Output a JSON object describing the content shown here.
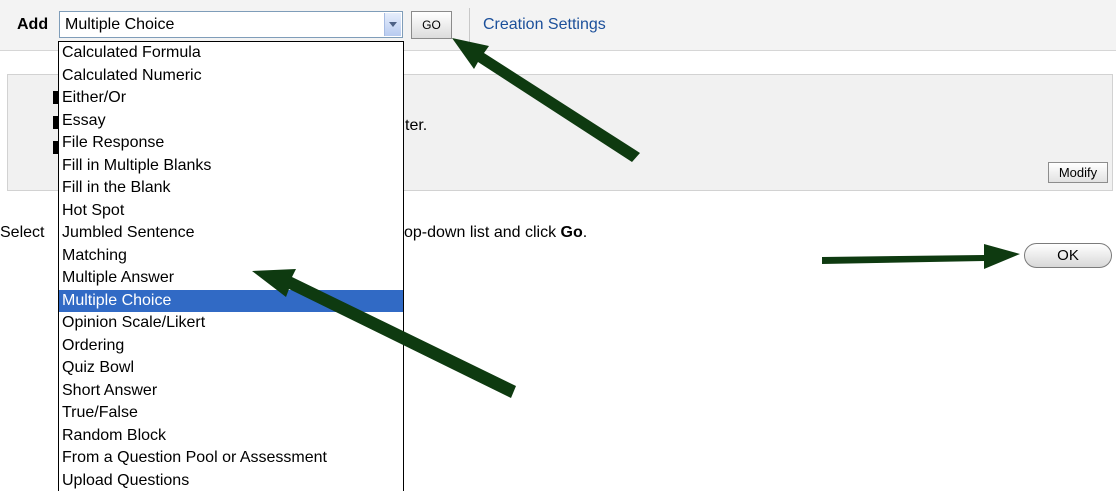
{
  "toolbar": {
    "add_label": "Add",
    "select_value": "Multiple Choice",
    "go_label": "GO",
    "creation_settings": "Creation Settings"
  },
  "info_box": {
    "line_fragment": "ter.",
    "modify_label": "Modify"
  },
  "instructions": {
    "prefix": "Select",
    "suffix_text": "op-down list and click ",
    "suffix_bold": "Go",
    "suffix_end": "."
  },
  "ok_label": "OK",
  "dropdown": {
    "options": [
      "Calculated Formula",
      "Calculated Numeric",
      "Either/Or",
      "Essay",
      "File Response",
      "Fill in Multiple Blanks",
      "Fill in the Blank",
      "Hot Spot",
      "Jumbled Sentence",
      "Matching",
      "Multiple Answer",
      "Multiple Choice",
      "Opinion Scale/Likert",
      "Ordering",
      "Quiz Bowl",
      "Short Answer",
      "True/False",
      "Random Block",
      "From a Question Pool or Assessment",
      "Upload Questions"
    ],
    "selected_index": 11
  },
  "colors": {
    "arrow": "#0e3a10",
    "highlight": "#316ac5",
    "link": "#1b4f9a"
  }
}
